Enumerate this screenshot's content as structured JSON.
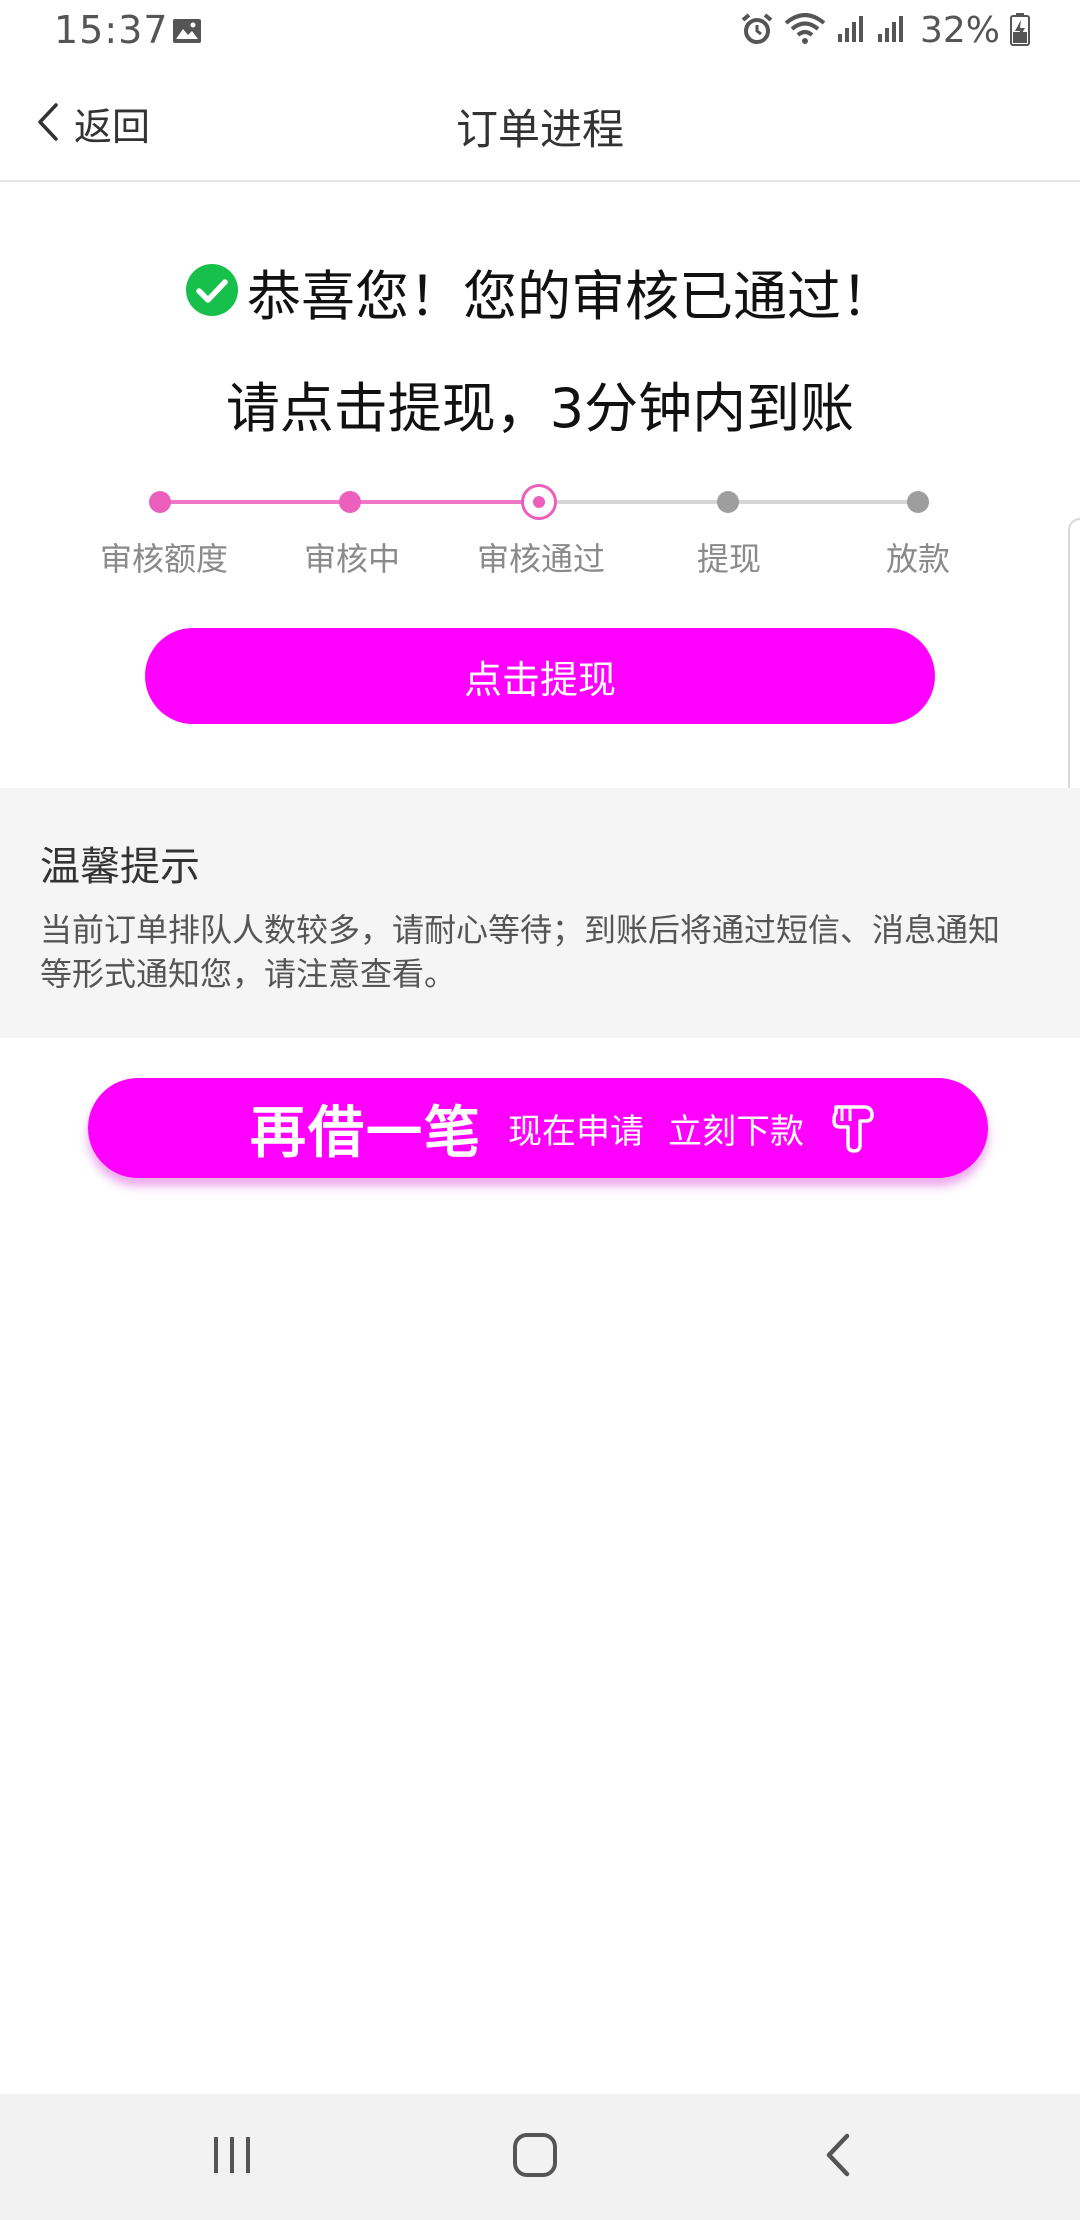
{
  "status_bar": {
    "time": "15:37",
    "battery": "32%",
    "icons": [
      "image-icon",
      "alarm-icon",
      "wifi-icon",
      "signal-icon",
      "signal-icon",
      "battery-charging-icon"
    ]
  },
  "header": {
    "back_label": "返回",
    "title": "订单进程"
  },
  "result": {
    "title": "恭喜您！您的审核已通过！",
    "subtitle": "请点击提现，3分钟内到账",
    "check_icon_color": "#16c04a"
  },
  "progress": {
    "steps": [
      {
        "label": "审核额度",
        "state": "done"
      },
      {
        "label": "审核中",
        "state": "done"
      },
      {
        "label": "审核通过",
        "state": "current"
      },
      {
        "label": "提现",
        "state": "todo"
      },
      {
        "label": "放款",
        "state": "todo"
      }
    ],
    "active_color": "#ec5fbd",
    "inactive_color": "#9e9e9e"
  },
  "withdraw_button": {
    "label": "点击提现",
    "color": "#ff00ff"
  },
  "tips": {
    "title": "温馨提示",
    "body": "当前订单排队人数较多，请耐心等待；到账后将通过短信、消息通知等形式通知您，请注意查看。"
  },
  "borrow_banner": {
    "main": "再借一笔",
    "sub1": "现在申请",
    "sub2": "立刻下款"
  },
  "nav_bar": {
    "icons": [
      "recent-apps-icon",
      "home-icon",
      "back-icon"
    ]
  }
}
